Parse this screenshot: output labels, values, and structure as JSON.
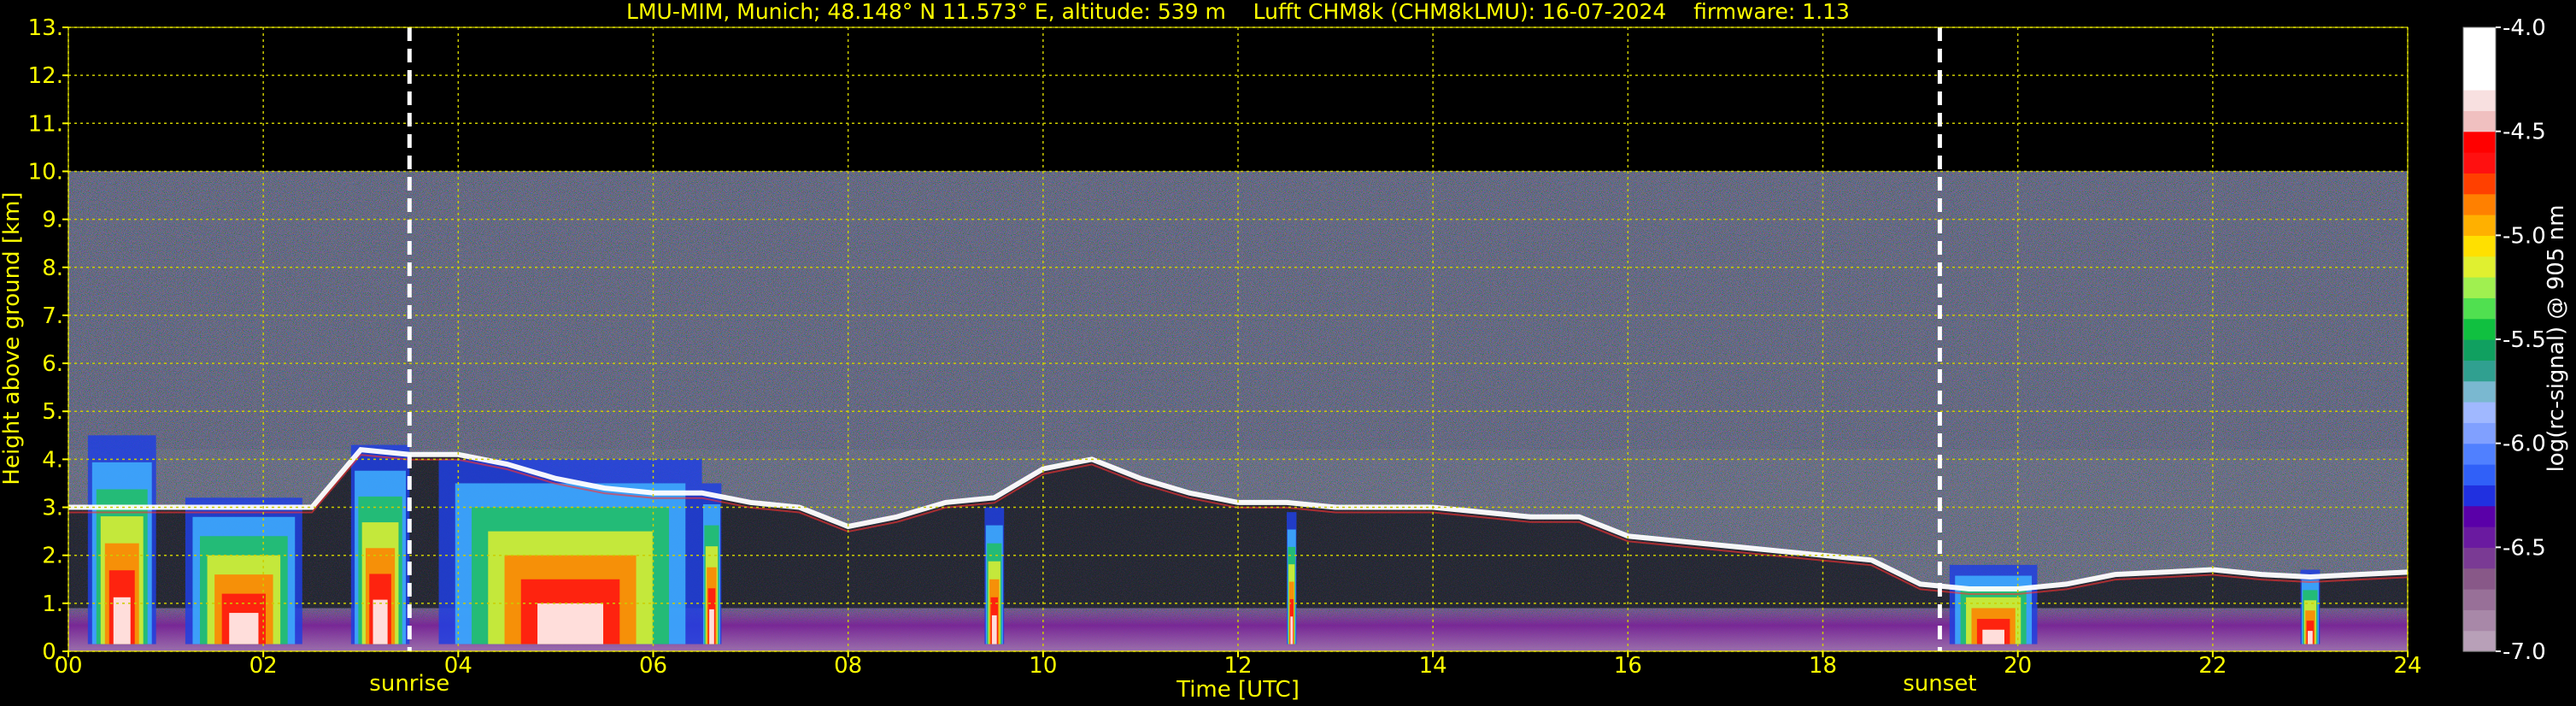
{
  "chart_data": {
    "type": "heatmap",
    "title": "LMU-MIM, Munich; 48.148° N 11.573° E, altitude: 539 m    Lufft CHM8k (CHM8kLMU): 16-07-2024    firmware: 1.13",
    "xlabel": "Time [UTC]",
    "ylabel": "Height above ground [km]",
    "xlim": [
      0,
      24
    ],
    "ylim": [
      0,
      13
    ],
    "x_ticks": [
      0,
      2,
      4,
      6,
      8,
      10,
      12,
      14,
      16,
      18,
      20,
      22,
      24
    ],
    "x_tick_labels": [
      "00",
      "02",
      "04",
      "06",
      "08",
      "10",
      "12",
      "14",
      "16",
      "18",
      "20",
      "22",
      "24"
    ],
    "y_ticks": [
      0,
      1,
      2,
      3,
      4,
      5,
      6,
      7,
      8,
      9,
      10,
      11,
      12,
      13
    ],
    "y_tick_labels": [
      "0.",
      "1.",
      "2.",
      "3.",
      "4.",
      "5.",
      "6.",
      "7.",
      "8.",
      "9.",
      "10.",
      "11.",
      "12.",
      "13."
    ],
    "grid": true,
    "data_top_km": 10,
    "markers": [
      {
        "label": "sunrise",
        "x": 3.5
      },
      {
        "label": "sunset",
        "x": 19.2
      }
    ],
    "cloud_layer_km": {
      "x": [
        0,
        0.5,
        1,
        1.5,
        2,
        2.5,
        3,
        3.5,
        4,
        4.5,
        5,
        5.5,
        6,
        6.5,
        7,
        7.5,
        8,
        8.5,
        9,
        9.5,
        10,
        10.5,
        11,
        11.5,
        12,
        12.5,
        13,
        13.5,
        14,
        14.5,
        15,
        15.5,
        16,
        16.5,
        17,
        17.5,
        18,
        18.5,
        19,
        19.5,
        20,
        20.5,
        21,
        21.5,
        22,
        22.5,
        23,
        23.5,
        24
      ],
      "y": [
        3.0,
        3.0,
        3.0,
        3.0,
        3.0,
        3.0,
        4.2,
        4.1,
        4.1,
        3.9,
        3.6,
        3.4,
        3.3,
        3.3,
        3.1,
        3.0,
        2.6,
        2.8,
        3.1,
        3.2,
        3.8,
        4.0,
        3.6,
        3.3,
        3.1,
        3.1,
        3.0,
        3.0,
        3.0,
        2.9,
        2.8,
        2.8,
        2.4,
        2.3,
        2.2,
        2.1,
        2.0,
        1.9,
        1.4,
        1.3,
        1.3,
        1.4,
        1.6,
        1.65,
        1.7,
        1.6,
        1.55,
        1.6,
        1.65
      ]
    },
    "colorbar": {
      "label": "log(rc-signal) @ 905 nm",
      "range": [
        -7.0,
        -4.0
      ],
      "tick_values": [
        -4.0,
        -4.5,
        -5.0,
        -5.5,
        -6.0,
        -6.5,
        -7.0
      ],
      "tick_labels": [
        "-4.0",
        "-4.5",
        "-5.0",
        "-5.5",
        "-6.0",
        "-6.5",
        "-7.0"
      ],
      "colors_low_to_high": [
        "#b8a0b8",
        "#a888a8",
        "#987098",
        "#885888",
        "#7a3a94",
        "#6a1aa0",
        "#5a00a8",
        "#2030e0",
        "#3060f8",
        "#5080ff",
        "#80a0ff",
        "#a0b8ff",
        "#7ab8d0",
        "#30a090",
        "#10a060",
        "#10c040",
        "#50e050",
        "#a0f050",
        "#e0f030",
        "#ffe000",
        "#ffb000",
        "#ff8000",
        "#ff4000",
        "#ff1010",
        "#ff0000",
        "#f0c0c0",
        "#f8e0e0",
        "#ffffff",
        "#ffffff",
        "#ffffff"
      ]
    },
    "colors": {
      "background": "#000000",
      "text": "#ffff00",
      "grid": "#cccc00",
      "marker_line": "#ffffff",
      "noise_background": "#3a3a6a"
    }
  }
}
